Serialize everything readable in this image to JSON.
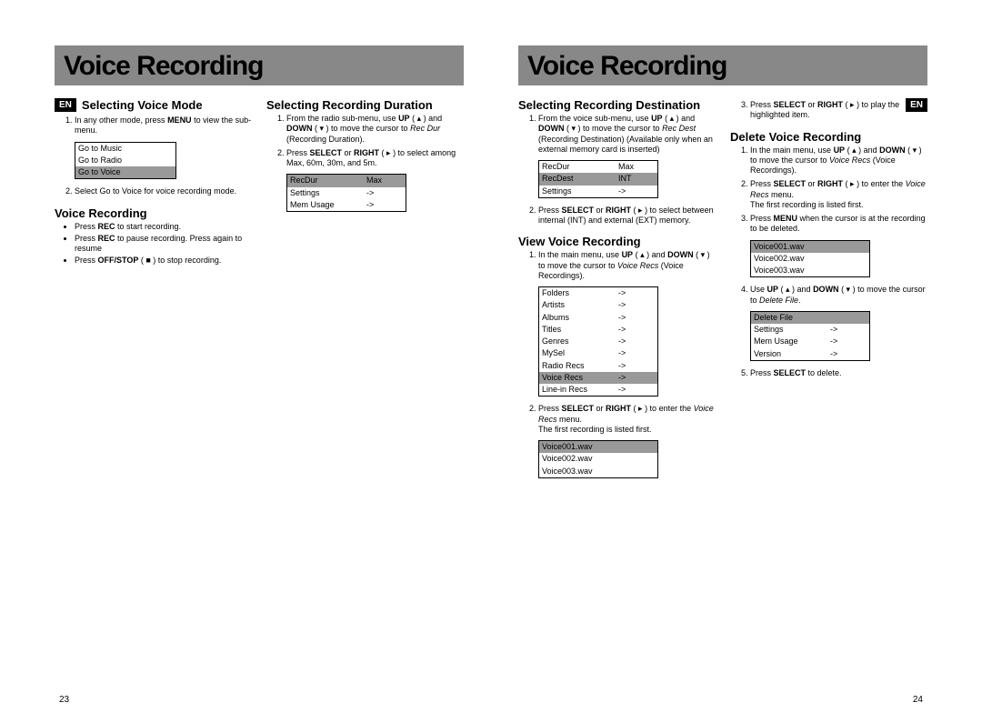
{
  "pageLeft": {
    "title": "Voice Recording",
    "lang": "EN",
    "sec1": {
      "h": "Selecting Voice Mode",
      "li1a": "In any other mode, press ",
      "li1b": "MENU",
      "li1c": " to view the sub-menu.",
      "li2": "Select Go to Voice for voice recording mode.",
      "menu": {
        "r1": "Go to Music",
        "r2": "Go to Radio",
        "r3": "Go to Voice"
      }
    },
    "sec2": {
      "h": "Voice Recording",
      "b1a": "Press ",
      "b1b": "REC",
      "b1c": " to start recording.",
      "b2a": "Press ",
      "b2b": "REC",
      "b2c": " to pause recording. Press again to resume",
      "b3a": "Press ",
      "b3b": "OFF/STOP",
      "b3c": " ( ■ )  to stop recording."
    },
    "sec3": {
      "h": "Selecting Recording Duration",
      "li1a": "From the radio sub-menu, use ",
      "li1b": "UP",
      "li1c": " ( ▴ ) and ",
      "li1d": "DOWN",
      "li1e": " ( ▾ ) to move the cursor to ",
      "li1f": "Rec Dur",
      "li1g": " (Recording Duration).",
      "li2a": "Press ",
      "li2b": "SELECT",
      "li2c": " or ",
      "li2d": "RIGHT",
      "li2e": " ( ▸ ) to select among Max, 60m, 30m, and 5m.",
      "menu": {
        "r1a": "RecDur",
        "r1b": "Max",
        "r2a": "Settings",
        "r2b": "->",
        "r3a": "Mem Usage",
        "r3b": "->"
      }
    },
    "pageNum": "23"
  },
  "pageRight": {
    "title": "Voice Recording",
    "lang": "EN",
    "sec1": {
      "h": "Selecting Recording Destination",
      "li1a": "From the voice sub-menu, use ",
      "li1b": "UP",
      "li1c": " ( ▴ ) and ",
      "li1d": "DOWN",
      "li1e": " ( ▾ ) to move the cursor to ",
      "li1f": "Rec Dest",
      "li1g": " (Recording Destination) (Available only when an external memory card is inserted)",
      "li2a": "Press ",
      "li2b": "SELECT",
      "li2c": " or ",
      "li2d": "RIGHT",
      "li2e": " ( ▸ ) to select between internal (INT) and external (EXT) memory.",
      "menu": {
        "r1a": "RecDur",
        "r1b": "Max",
        "r2a": "RecDest",
        "r2b": "INT",
        "r3a": "Settings",
        "r3b": "->"
      }
    },
    "sec2": {
      "h": "View Voice Recording",
      "li1a": "In the main menu, use ",
      "li1b": "UP",
      "li1c": " ( ▴ ) and ",
      "li1d": "DOWN",
      "li1e": " ( ▾ ) to move the cursor to ",
      "li1f": "Voice Recs",
      "li1g": " (Voice Recordings).",
      "li2a": "Press ",
      "li2b": "SELECT",
      "li2c": " or ",
      "li2d": "RIGHT",
      "li2e": " ( ▸ ) to enter the ",
      "li2f": "Voice Recs",
      "li2g": " menu.",
      "li2h": "The first recording is listed first.",
      "menu": {
        "r1a": "Folders",
        "r1b": "->",
        "r2a": "Artists",
        "r2b": "->",
        "r3a": "Albums",
        "r3b": "->",
        "r4a": "Titles",
        "r4b": "->",
        "r5a": "Genres",
        "r5b": "->",
        "r6a": "MySel",
        "r6b": "->",
        "r7a": "Radio Recs",
        "r7b": "->",
        "r8a": "Voice Recs",
        "r8b": "->",
        "r9a": "Line-in Recs",
        "r9b": "->"
      },
      "fileMenu": {
        "r1": "Voice001.wav",
        "r2": "Voice002.wav",
        "r3": "Voice003.wav"
      }
    },
    "col2top": {
      "li3a": "Press ",
      "li3b": "SELECT",
      "li3c": " or ",
      "li3d": "RIGHT",
      "li3e": " ( ▸ ) to play the highlighted item."
    },
    "sec3": {
      "h": "Delete Voice Recording",
      "li1a": "In the main menu, use ",
      "li1b": "UP",
      "li1c": " ( ▴ ) and ",
      "li1d": "DOWN",
      "li1e": " ( ▾ ) to move the cursor to ",
      "li1f": "Voice Recs",
      "li1g": " (Voice Recordings).",
      "li2a": "Press ",
      "li2b": "SELECT",
      "li2c": " or ",
      "li2d": "RIGHT",
      "li2e": " ( ▸ ) to enter the ",
      "li2f": "Voice Recs",
      "li2g": " menu.",
      "li2h": "The first recording is listed first.",
      "li3a": "Press ",
      "li3b": "MENU",
      "li3c": " when the cursor is at the recording to be deleted.",
      "fileMenu": {
        "r1": "Voice001.wav",
        "r2": "Voice002.wav",
        "r3": "Voice003.wav"
      },
      "li4a": "Use ",
      "li4b": "UP",
      "li4c": " ( ▴ ) and ",
      "li4d": "DOWN",
      "li4e": " ( ▾ ) to move the cursor to ",
      "li4f": "Delete File",
      "li4g": ".",
      "delMenu": {
        "r1a": "Delete File",
        "r1b": "",
        "r2a": "Settings",
        "r2b": "->",
        "r3a": "Mem Usage",
        "r3b": "->",
        "r4a": "Version",
        "r4b": "->"
      },
      "li5a": "Press ",
      "li5b": "SELECT",
      "li5c": " to delete."
    },
    "pageNum": "24"
  }
}
